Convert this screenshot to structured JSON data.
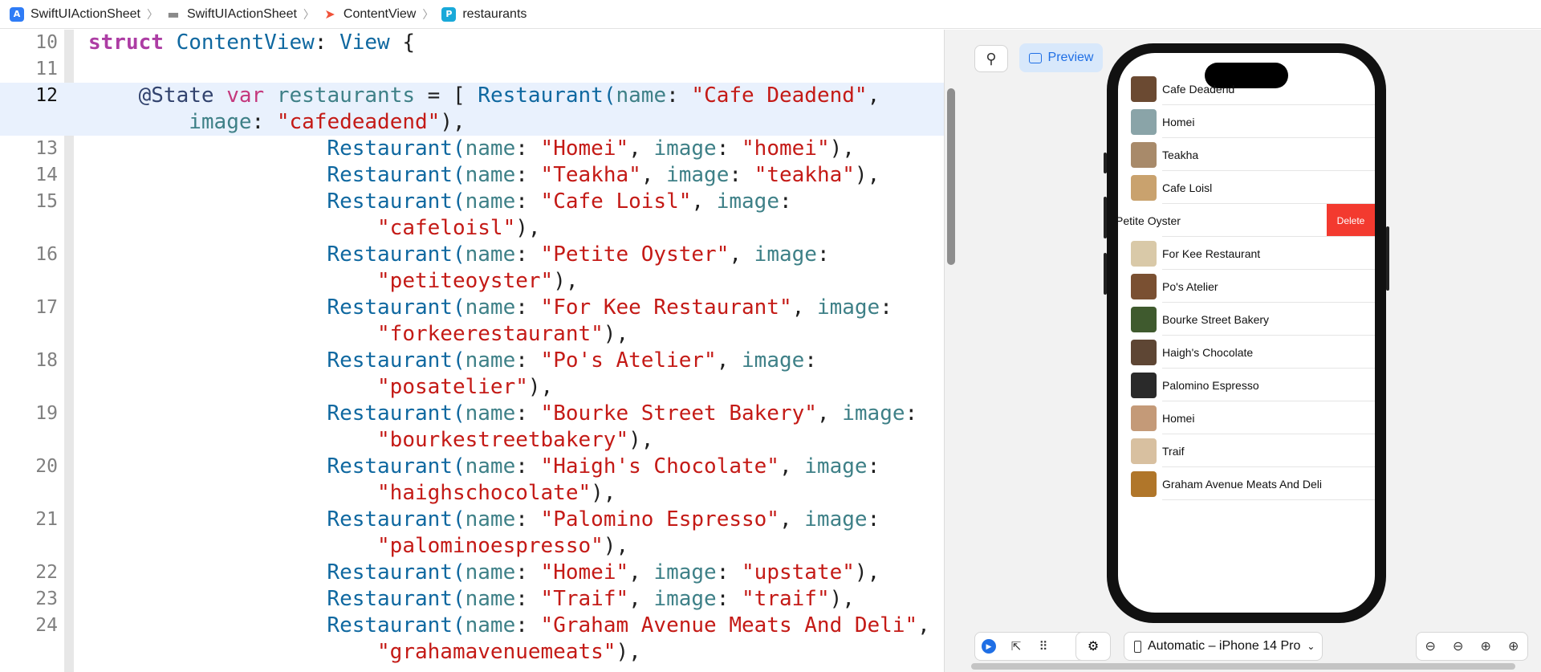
{
  "breadcrumb": {
    "items": [
      {
        "label": "SwiftUIActionSheet",
        "icon": "app-icon"
      },
      {
        "label": "SwiftUIActionSheet",
        "icon": "folder-icon"
      },
      {
        "label": "ContentView",
        "icon": "swift-file-icon"
      },
      {
        "label": "restaurants",
        "icon": "property-icon",
        "icon_glyph": "P"
      }
    ]
  },
  "editor": {
    "line_numbers": [
      "10",
      "11",
      "12",
      "13",
      "14",
      "15",
      "16",
      "17",
      "18",
      "19",
      "20",
      "21",
      "22",
      "23",
      "24"
    ],
    "current_line": "12",
    "code": {
      "l10": {
        "kw": "struct",
        "type_name": "ContentView",
        "colon": ": ",
        "proto": "View",
        "rest": " {"
      },
      "l12": {
        "attr": "@State",
        "kw": "var",
        "name": "restaurants",
        "eq": " = [ ",
        "ctor": "Restaurant(",
        "p1": "name",
        "s1": "\"Cafe Deadend\"",
        "tail": ","
      },
      "l12b": {
        "p2": "image",
        "s2": "\"cafedeadend\"",
        "end": "),"
      },
      "rows": [
        {
          "name": "\"Homei\"",
          "image": "\"homei\"",
          "wrap": false
        },
        {
          "name": "\"Teakha\"",
          "image": "\"teakha\"",
          "wrap": false
        },
        {
          "name": "\"Cafe Loisl\"",
          "image": "\"cafeloisl\"",
          "wrap": true
        },
        {
          "name": "\"Petite Oyster\"",
          "image": "\"petiteoyster\"",
          "wrap": true
        },
        {
          "name": "\"For Kee Restaurant\"",
          "image": "\"forkeerestaurant\"",
          "wrap": true
        },
        {
          "name": "\"Po's Atelier\"",
          "image": "\"posatelier\"",
          "wrap": true
        },
        {
          "name": "\"Bourke Street Bakery\"",
          "image": "\"bourkestreetbakery\"",
          "wrap": true
        },
        {
          "name": "\"Haigh's Chocolate\"",
          "image": "\"haighschocolate\"",
          "wrap": true
        },
        {
          "name": "\"Palomino Espresso\"",
          "image": "\"palominoespresso\"",
          "wrap": true
        },
        {
          "name": "\"Homei\"",
          "image": "\"upstate\"",
          "wrap": false
        },
        {
          "name": "\"Traif\"",
          "image": "\"traif\"",
          "wrap": false
        },
        {
          "name": "\"Graham Avenue Meats And Deli\"",
          "image": "\"grahamavenuemeats\"",
          "wrap": true
        }
      ],
      "tokens": {
        "ctor": "Restaurant(",
        "name": "name",
        "image": "image",
        "sep": ": ",
        "comma": ", ",
        "close": "),"
      }
    }
  },
  "preview": {
    "pin_glyph": "⚲",
    "preview_label": "Preview",
    "list": [
      {
        "name": "Cafe Deadend",
        "color": "#6b4a32"
      },
      {
        "name": "Homei",
        "color": "#8aa4a8"
      },
      {
        "name": "Teakha",
        "color": "#a88a6a"
      },
      {
        "name": "Cafe Loisl",
        "color": "#c9a26e"
      },
      {
        "name": "Petite Oyster",
        "color": "#b5b0a4",
        "swiped": true
      },
      {
        "name": "For Kee Restaurant",
        "color": "#d9c9a8"
      },
      {
        "name": "Po's Atelier",
        "color": "#7a5032"
      },
      {
        "name": "Bourke Street Bakery",
        "color": "#3f5a2e"
      },
      {
        "name": "Haigh's Chocolate",
        "color": "#5e4634"
      },
      {
        "name": "Palomino Espresso",
        "color": "#2a2a2a"
      },
      {
        "name": "Homei",
        "color": "#c49a78"
      },
      {
        "name": "Traif",
        "color": "#d8c0a0"
      },
      {
        "name": "Graham Avenue Meats And Deli",
        "color": "#b0762a"
      }
    ],
    "delete_label": "Delete",
    "device_label": "Automatic – iPhone 14 Pro",
    "device_chevron": "⌄",
    "mode_icons": [
      "▶",
      "⇱",
      "⠿"
    ],
    "settings_glyph": "⚙",
    "zoom_icons": [
      "⊖",
      "⊖",
      "⊕",
      "⊕"
    ]
  },
  "colors": {
    "accent": "#1f6fe5",
    "delete": "#f33a2f",
    "keyword": "#ad3da4",
    "string": "#c41a16",
    "param": "#3e8087"
  }
}
